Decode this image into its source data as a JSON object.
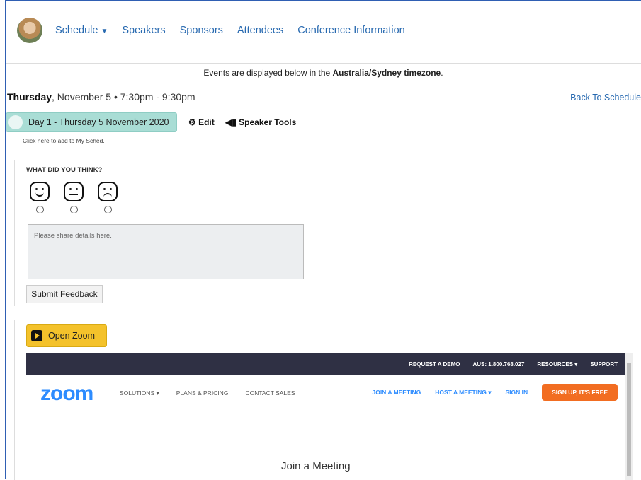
{
  "nav": {
    "items": [
      "Schedule",
      "Speakers",
      "Sponsors",
      "Attendees",
      "Conference Information"
    ]
  },
  "timezone": {
    "prefix": "Events are displayed below in the ",
    "zone": "Australia/Sydney timezone",
    "suffix": "."
  },
  "event": {
    "day": "Thursday",
    "date_time": ", November 5 • 7:30pm - 9:30pm",
    "back_label": "Back To Schedule",
    "tag": "Day 1 - Thursday 5 November 2020",
    "edit_label": "Edit",
    "speaker_tools_label": "Speaker Tools",
    "add_hint": "Click here to add to My Sched."
  },
  "feedback": {
    "title": "WHAT DID YOU THINK?",
    "textarea_placeholder": "Please share details here.",
    "submit_label": "Submit Feedback"
  },
  "zoom": {
    "open_label": "Open Zoom",
    "top_links": [
      "REQUEST A DEMO",
      "AUS: 1.800.768.027",
      "RESOURCES ▾",
      "SUPPORT"
    ],
    "logo": "zoom",
    "nav_links": [
      "SOLUTIONS ▾",
      "PLANS & PRICING",
      "CONTACT SALES"
    ],
    "right_links": [
      "JOIN A MEETING",
      "HOST A MEETING ▾",
      "SIGN IN"
    ],
    "signup": "SIGN UP, IT'S FREE",
    "page_title": "Join a Meeting"
  }
}
